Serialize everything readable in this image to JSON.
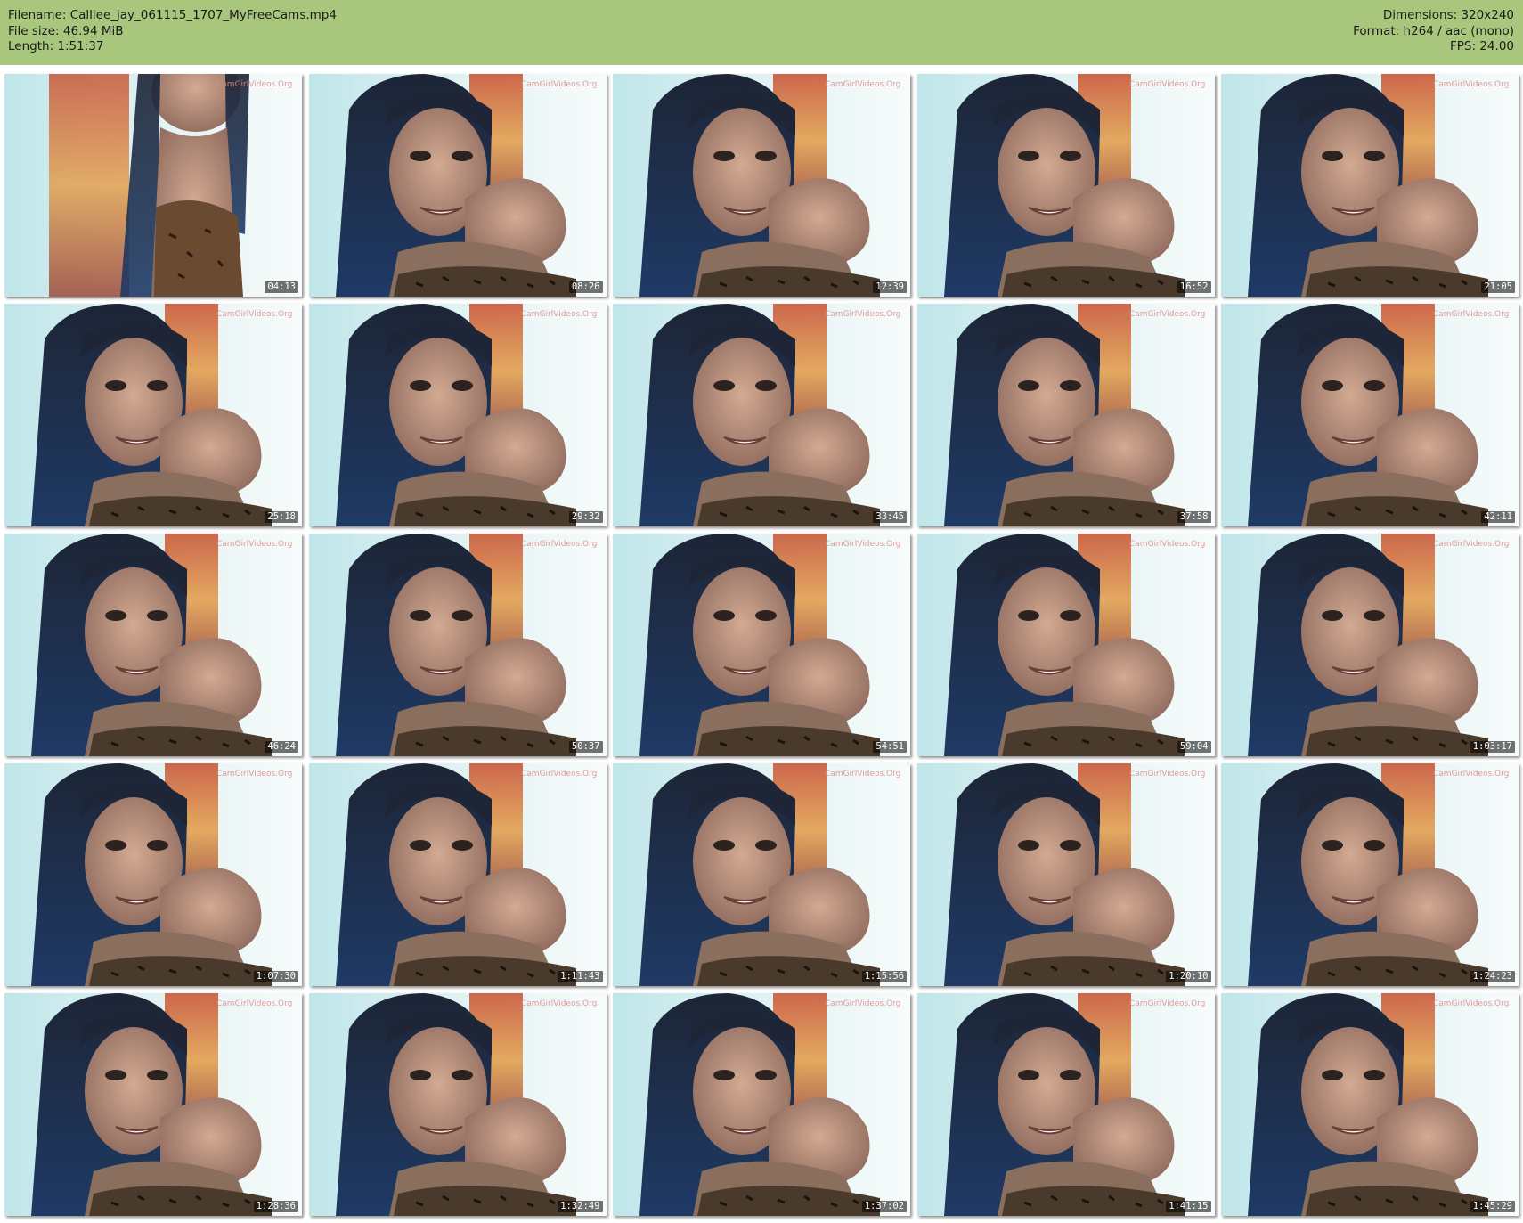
{
  "header": {
    "filename": "Filename: Calliee_jay_061115_1707_MyFreeCams.mp4",
    "filesize": "File size: 46.94 MiB",
    "length": "Length: 1:51:37",
    "dimensions": "Dimensions: 320x240",
    "format": "Format: h264 / aac (mono)",
    "fps": "FPS: 24.00",
    "background_color": "#a9c77c"
  },
  "watermark": "CamGirlVideos.Org",
  "frames": [
    {
      "timestamp": "04:13",
      "variant": "wide"
    },
    {
      "timestamp": "08:26",
      "variant": "close"
    },
    {
      "timestamp": "12:39",
      "variant": "close"
    },
    {
      "timestamp": "16:52",
      "variant": "close"
    },
    {
      "timestamp": "21:05",
      "variant": "close"
    },
    {
      "timestamp": "25:18",
      "variant": "close"
    },
    {
      "timestamp": "29:32",
      "variant": "close"
    },
    {
      "timestamp": "33:45",
      "variant": "close"
    },
    {
      "timestamp": "37:58",
      "variant": "close"
    },
    {
      "timestamp": "42:11",
      "variant": "close"
    },
    {
      "timestamp": "46:24",
      "variant": "close"
    },
    {
      "timestamp": "50:37",
      "variant": "close"
    },
    {
      "timestamp": "54:51",
      "variant": "close"
    },
    {
      "timestamp": "59:04",
      "variant": "close"
    },
    {
      "timestamp": "1:03:17",
      "variant": "close"
    },
    {
      "timestamp": "1:07:30",
      "variant": "close"
    },
    {
      "timestamp": "1:11:43",
      "variant": "close"
    },
    {
      "timestamp": "1:15:56",
      "variant": "close"
    },
    {
      "timestamp": "1:20:10",
      "variant": "close"
    },
    {
      "timestamp": "1:24:23",
      "variant": "close"
    },
    {
      "timestamp": "1:28:36",
      "variant": "close"
    },
    {
      "timestamp": "1:32:49",
      "variant": "close"
    },
    {
      "timestamp": "1:37:02",
      "variant": "close"
    },
    {
      "timestamp": "1:41:15",
      "variant": "close"
    },
    {
      "timestamp": "1:45:29",
      "variant": "close"
    }
  ]
}
